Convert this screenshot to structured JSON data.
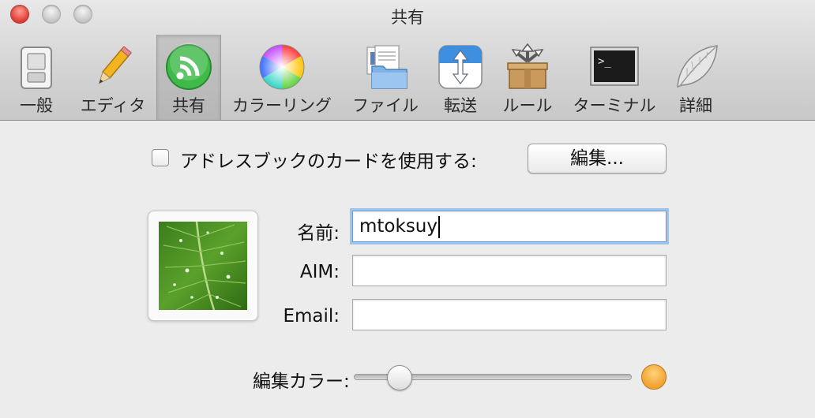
{
  "window": {
    "title": "共有"
  },
  "toolbar": {
    "items": [
      {
        "label": "一般",
        "icon": "switch-icon"
      },
      {
        "label": "エディタ",
        "icon": "pencil-icon"
      },
      {
        "label": "共有",
        "icon": "share-icon",
        "selected": true
      },
      {
        "label": "カラーリング",
        "icon": "color-wheel-icon"
      },
      {
        "label": "ファイル",
        "icon": "folder-icon"
      },
      {
        "label": "転送",
        "icon": "transfer-icon"
      },
      {
        "label": "ルール",
        "icon": "rules-box-icon"
      },
      {
        "label": "ターミナル",
        "icon": "terminal-icon"
      },
      {
        "label": "詳細",
        "icon": "leaf-icon"
      }
    ]
  },
  "address_book": {
    "checkbox_label": "アドレスブックのカードを使用する:",
    "checked": false,
    "edit_button": "編集..."
  },
  "profile": {
    "photo": "leaf-photo",
    "name_label": "名前:",
    "name_value": "mtoksuy",
    "aim_label": "AIM:",
    "aim_value": "",
    "email_label": "Email:",
    "email_value": ""
  },
  "color": {
    "label": "編集カラー:",
    "slider_fraction": 0.13,
    "swatch": "#f2a534"
  }
}
